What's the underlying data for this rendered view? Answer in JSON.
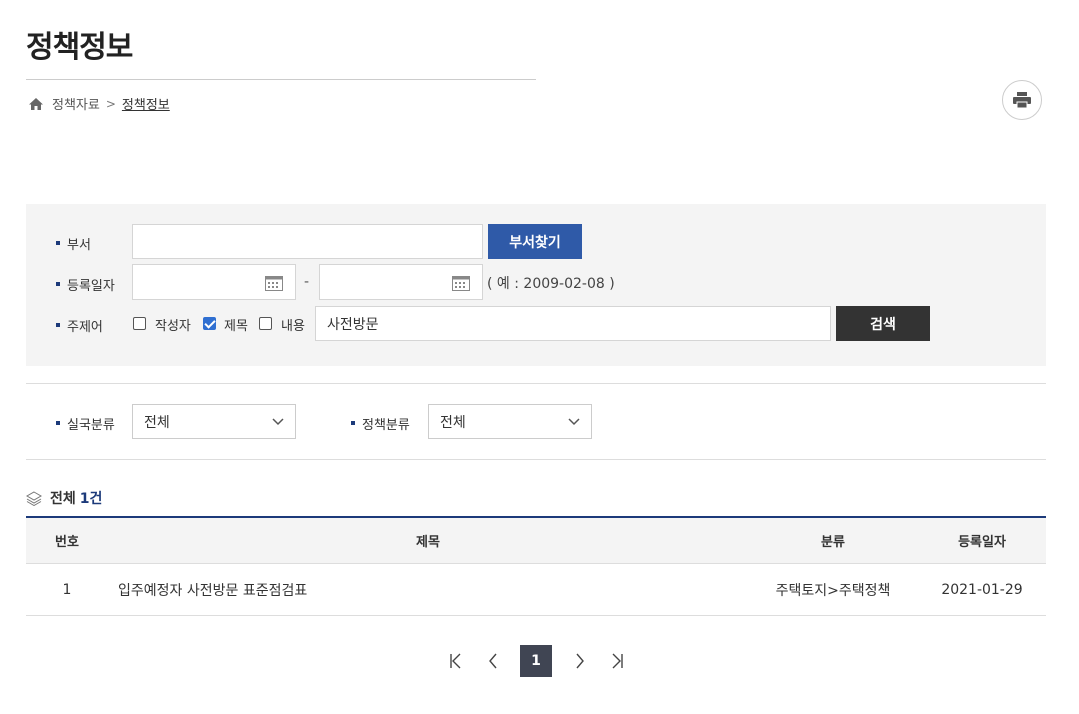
{
  "page": {
    "title": "정책정보"
  },
  "breadcrumb": {
    "parent": "정책자료",
    "current": "정책정보"
  },
  "icons": {
    "home": "home-icon",
    "print": "printer-icon",
    "calendar": "calendar-icon",
    "chevron": "chevron-down-icon",
    "stack": "layers-icon"
  },
  "search": {
    "dept_label": "부서",
    "dept_value": "",
    "dept_button": "부서찾기",
    "date_label": "등록일자",
    "date_from": "",
    "date_to": "",
    "date_sep": "-",
    "date_hint": "( 예 : 2009-02-08 )",
    "keyword_label": "주제어",
    "opt_author": "작성자",
    "opt_title": "제목",
    "opt_content": "내용",
    "checked": {
      "author": false,
      "title": true,
      "content": false
    },
    "keyword_value": "사전방문",
    "search_button": "검색"
  },
  "filters": {
    "office_label": "실국분류",
    "office_value": "전체",
    "policy_label": "정책분류",
    "policy_value": "전체"
  },
  "total": {
    "label": "전체",
    "count": "1건"
  },
  "table": {
    "headers": {
      "num": "번호",
      "title": "제목",
      "category": "분류",
      "date": "등록일자"
    },
    "rows": [
      {
        "num": "1",
        "title": "입주예정자 사전방문 표준점검표",
        "category": "주택토지>주택정책",
        "date": "2021-01-29"
      }
    ]
  },
  "pagination": {
    "current": "1"
  },
  "colors": {
    "accent": "#2f5aa8",
    "navy": "#1c3a7a",
    "dark_button": "#333333"
  }
}
